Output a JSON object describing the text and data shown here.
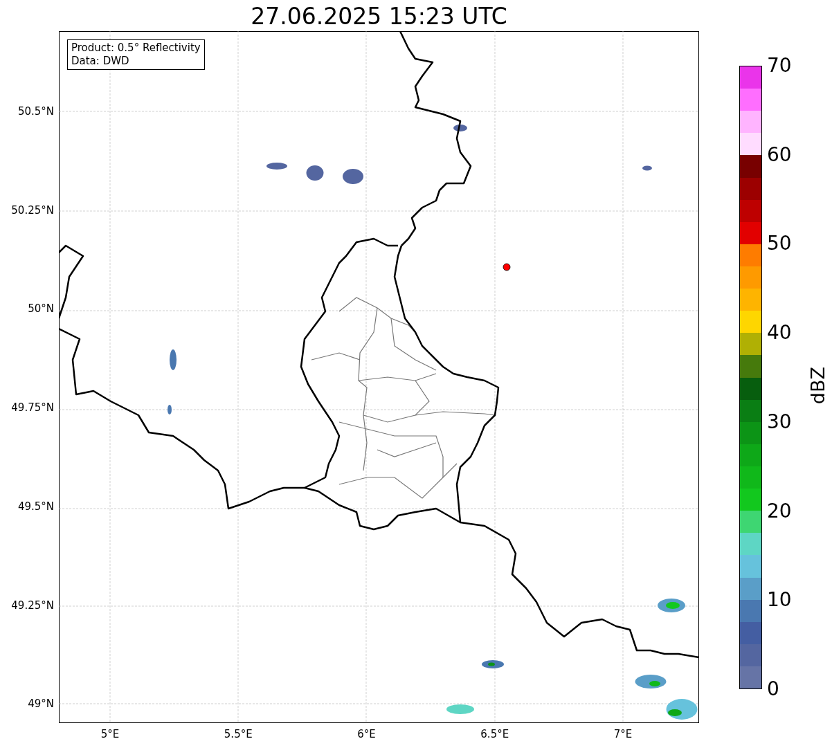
{
  "title": "27.06.2025 15:23 UTC",
  "info_box": [
    "Product: 0.5° Reflectivity",
    "Data: DWD"
  ],
  "x_ticks": [
    "5°E",
    "5.5°E",
    "6°E",
    "6.5°E",
    "7°E"
  ],
  "y_ticks": [
    "50.5°N",
    "50.25°N",
    "50°N",
    "49.75°N",
    "49.5°N",
    "49.25°N",
    "49°N"
  ],
  "colorbar": {
    "label": "dBZ",
    "ticks": [
      "70",
      "60",
      "50",
      "40",
      "30",
      "20",
      "10",
      "0"
    ],
    "segments": [
      {
        "color": "#ea34ea"
      },
      {
        "color": "#ff6eff"
      },
      {
        "color": "#ffb4ff"
      },
      {
        "color": "#ffdcff"
      },
      {
        "color": "#780000"
      },
      {
        "color": "#9c0000"
      },
      {
        "color": "#be0000"
      },
      {
        "color": "#e20000"
      },
      {
        "color": "#fe7c00"
      },
      {
        "color": "#fe9a00"
      },
      {
        "color": "#feb400"
      },
      {
        "color": "#fed600"
      },
      {
        "color": "#b0b004"
      },
      {
        "color": "#467a0c"
      },
      {
        "color": "#075e0e"
      },
      {
        "color": "#0a7e14"
      },
      {
        "color": "#0c9416"
      },
      {
        "color": "#0ea818"
      },
      {
        "color": "#10b81a"
      },
      {
        "color": "#12c81e"
      },
      {
        "color": "#3ed672"
      },
      {
        "color": "#5ed6c4"
      },
      {
        "color": "#66c2dc"
      },
      {
        "color": "#5a9ec8"
      },
      {
        "color": "#4a78b0"
      },
      {
        "color": "#445ea2"
      },
      {
        "color": "#5466a0"
      },
      {
        "color": "#6674a6"
      }
    ]
  }
}
